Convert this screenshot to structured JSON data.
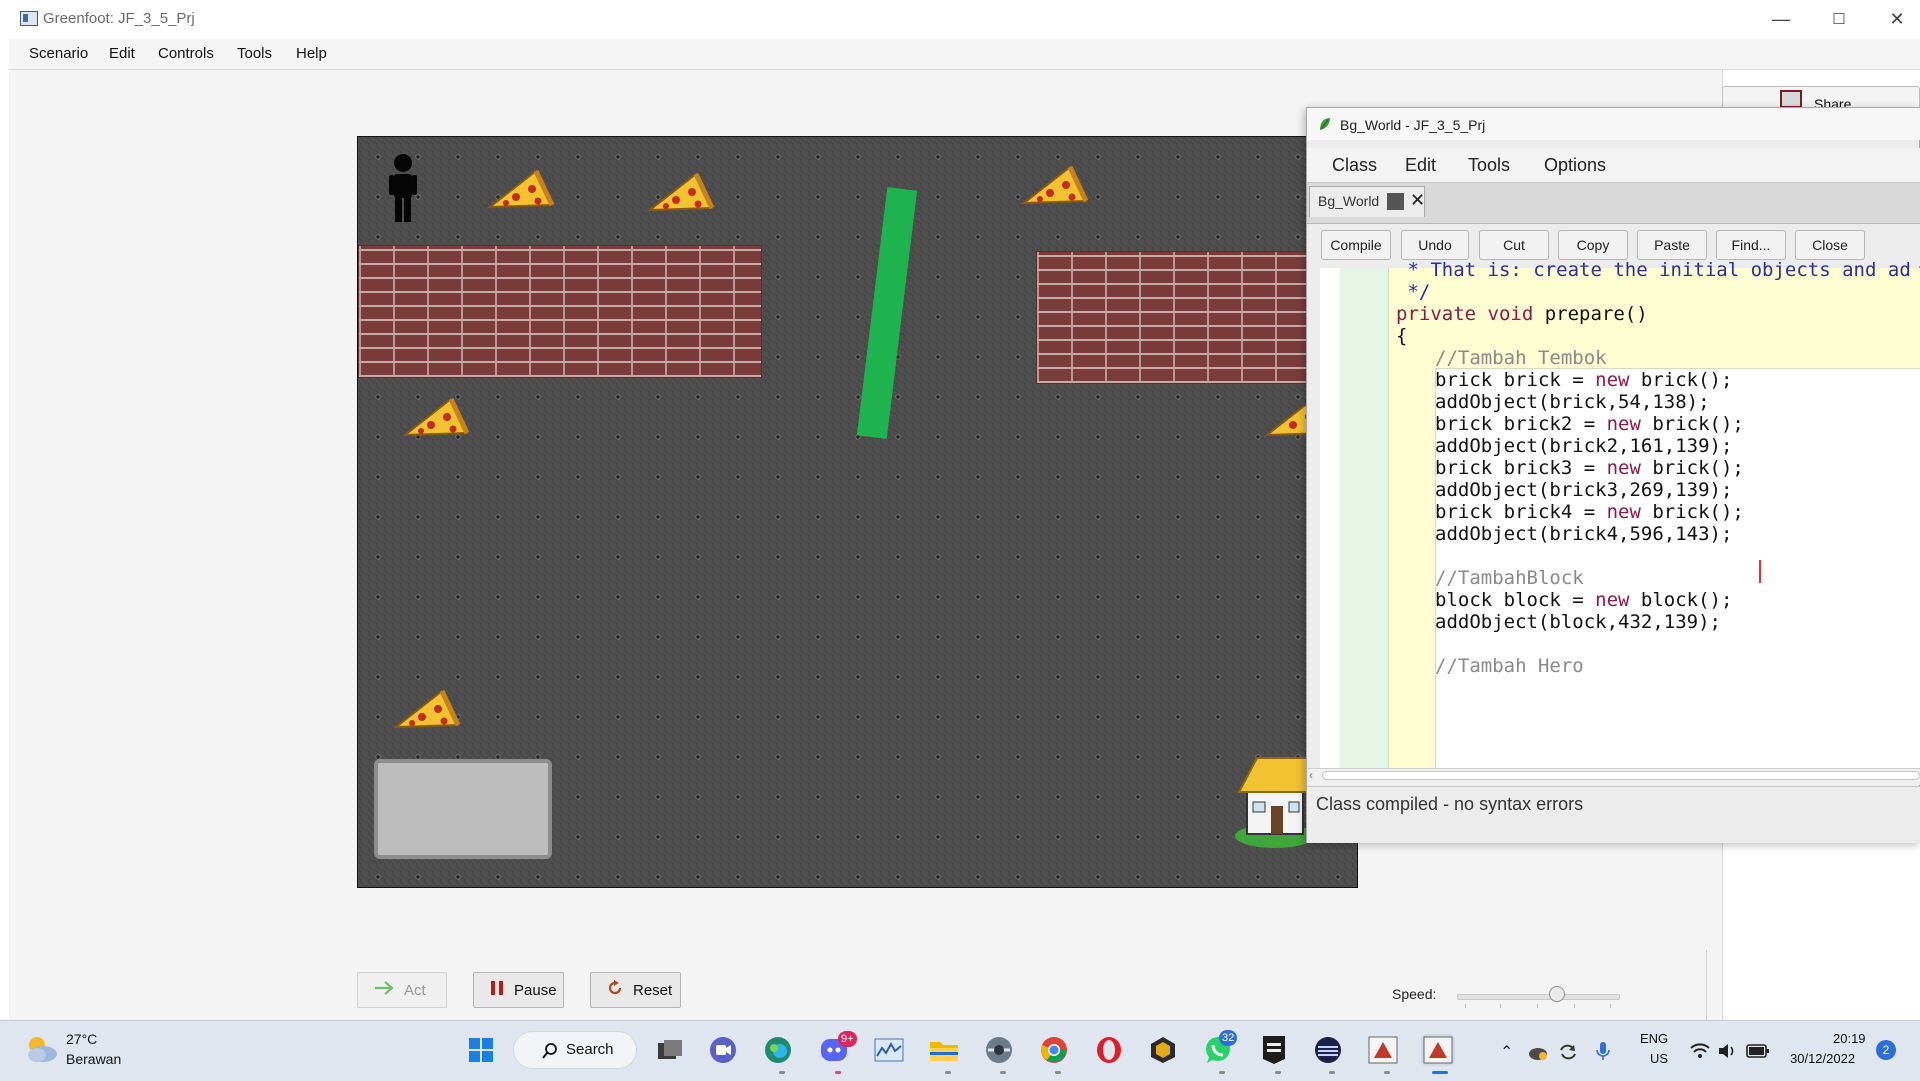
{
  "greenfoot": {
    "title": "Greenfoot: JF_3_5_Prj",
    "window_controls": [
      "—",
      "☐",
      "✕"
    ],
    "menu": [
      "Scenario",
      "Edit",
      "Controls",
      "Tools",
      "Help"
    ],
    "share_label": "Share",
    "controls": {
      "act_label": "Act",
      "pause_label": "Pause",
      "reset_label": "Reset",
      "speed_label": "Speed:",
      "speed_value": 0.5
    }
  },
  "world": {
    "actors": [
      "hero",
      "pizza",
      "brick",
      "block",
      "house",
      "panel"
    ]
  },
  "editor": {
    "title": "Bg_World - JF_3_5_Prj",
    "menu": [
      "Class",
      "Edit",
      "Tools",
      "Options"
    ],
    "tab_label": "Bg_World",
    "tab_close": "✕",
    "toolbar": [
      "Compile",
      "Undo",
      "Cut",
      "Copy",
      "Paste",
      "Find...",
      "Close"
    ],
    "code_lines": [
      {
        "indent": 0,
        "tokens": [
          {
            "t": " * That is: create the initial objects and ad",
            "c": "doc"
          }
        ]
      },
      {
        "indent": 0,
        "tokens": [
          {
            "t": " */",
            "c": "doc"
          }
        ]
      },
      {
        "indent": 0,
        "tokens": [
          {
            "t": "private void",
            "c": "kw"
          },
          {
            "t": " prepare()",
            "c": "plain"
          }
        ]
      },
      {
        "indent": 0,
        "tokens": [
          {
            "t": "{",
            "c": "plain"
          }
        ]
      },
      {
        "indent": 1,
        "tokens": [
          {
            "t": "//Tambah Tembok",
            "c": "cm"
          }
        ]
      },
      {
        "indent": 1,
        "tokens": [
          {
            "t": "brick brick = ",
            "c": "plain"
          },
          {
            "t": "new",
            "c": "kw"
          },
          {
            "t": " brick();",
            "c": "plain"
          }
        ]
      },
      {
        "indent": 1,
        "tokens": [
          {
            "t": "addObject(brick,54,138);",
            "c": "plain"
          }
        ]
      },
      {
        "indent": 1,
        "tokens": [
          {
            "t": "brick brick2 = ",
            "c": "plain"
          },
          {
            "t": "new",
            "c": "kw"
          },
          {
            "t": " brick();",
            "c": "plain"
          }
        ]
      },
      {
        "indent": 1,
        "tokens": [
          {
            "t": "addObject(brick2,161,139);",
            "c": "plain"
          }
        ]
      },
      {
        "indent": 1,
        "tokens": [
          {
            "t": "brick brick3 = ",
            "c": "plain"
          },
          {
            "t": "new",
            "c": "kw"
          },
          {
            "t": " brick();",
            "c": "plain"
          }
        ]
      },
      {
        "indent": 1,
        "tokens": [
          {
            "t": "addObject(brick3,269,139);",
            "c": "plain"
          }
        ]
      },
      {
        "indent": 1,
        "tokens": [
          {
            "t": "brick brick4 = ",
            "c": "plain"
          },
          {
            "t": "new",
            "c": "kw"
          },
          {
            "t": " brick();",
            "c": "plain"
          }
        ]
      },
      {
        "indent": 1,
        "tokens": [
          {
            "t": "addObject(brick4,596,143);",
            "c": "plain"
          }
        ]
      },
      {
        "indent": 1,
        "tokens": []
      },
      {
        "indent": 1,
        "tokens": [
          {
            "t": "//TambahBlock",
            "c": "cm"
          }
        ]
      },
      {
        "indent": 1,
        "tokens": [
          {
            "t": "block block = ",
            "c": "plain"
          },
          {
            "t": "new",
            "c": "kw"
          },
          {
            "t": " block();",
            "c": "plain"
          }
        ]
      },
      {
        "indent": 1,
        "tokens": [
          {
            "t": "addObject(block,432,139);",
            "c": "plain"
          }
        ]
      },
      {
        "indent": 1,
        "tokens": []
      },
      {
        "indent": 1,
        "tokens": [
          {
            "t": "//Tambah Hero",
            "c": "cm"
          }
        ]
      }
    ],
    "status": "Class compiled - no syntax errors"
  },
  "taskbar": {
    "weather_temp": "27°C",
    "weather_desc": "Berawan",
    "search_label": "Search",
    "apps": [
      "start",
      "search",
      "task-view",
      "meet",
      "edge",
      "discord",
      "monitor",
      "explorer",
      "steam",
      "chrome",
      "opera",
      "unity",
      "whatsapp",
      "epic-games",
      "app-menu",
      "greenfoot-1",
      "greenfoot-2"
    ],
    "discord_badge": "9+",
    "whatsapp_badge": "32",
    "lang_top": "ENG",
    "lang_bottom": "US",
    "time": "20:19",
    "date": "30/12/2022",
    "notifications": "2"
  },
  "colors": {
    "block_green": "#1eb34f",
    "keyword": "#8a1a4a",
    "doc_comment": "#2d2d9e",
    "comment": "#8a8a8a",
    "method_bg": "#fdfdd2",
    "gutter_green": "#e7f5e6"
  }
}
